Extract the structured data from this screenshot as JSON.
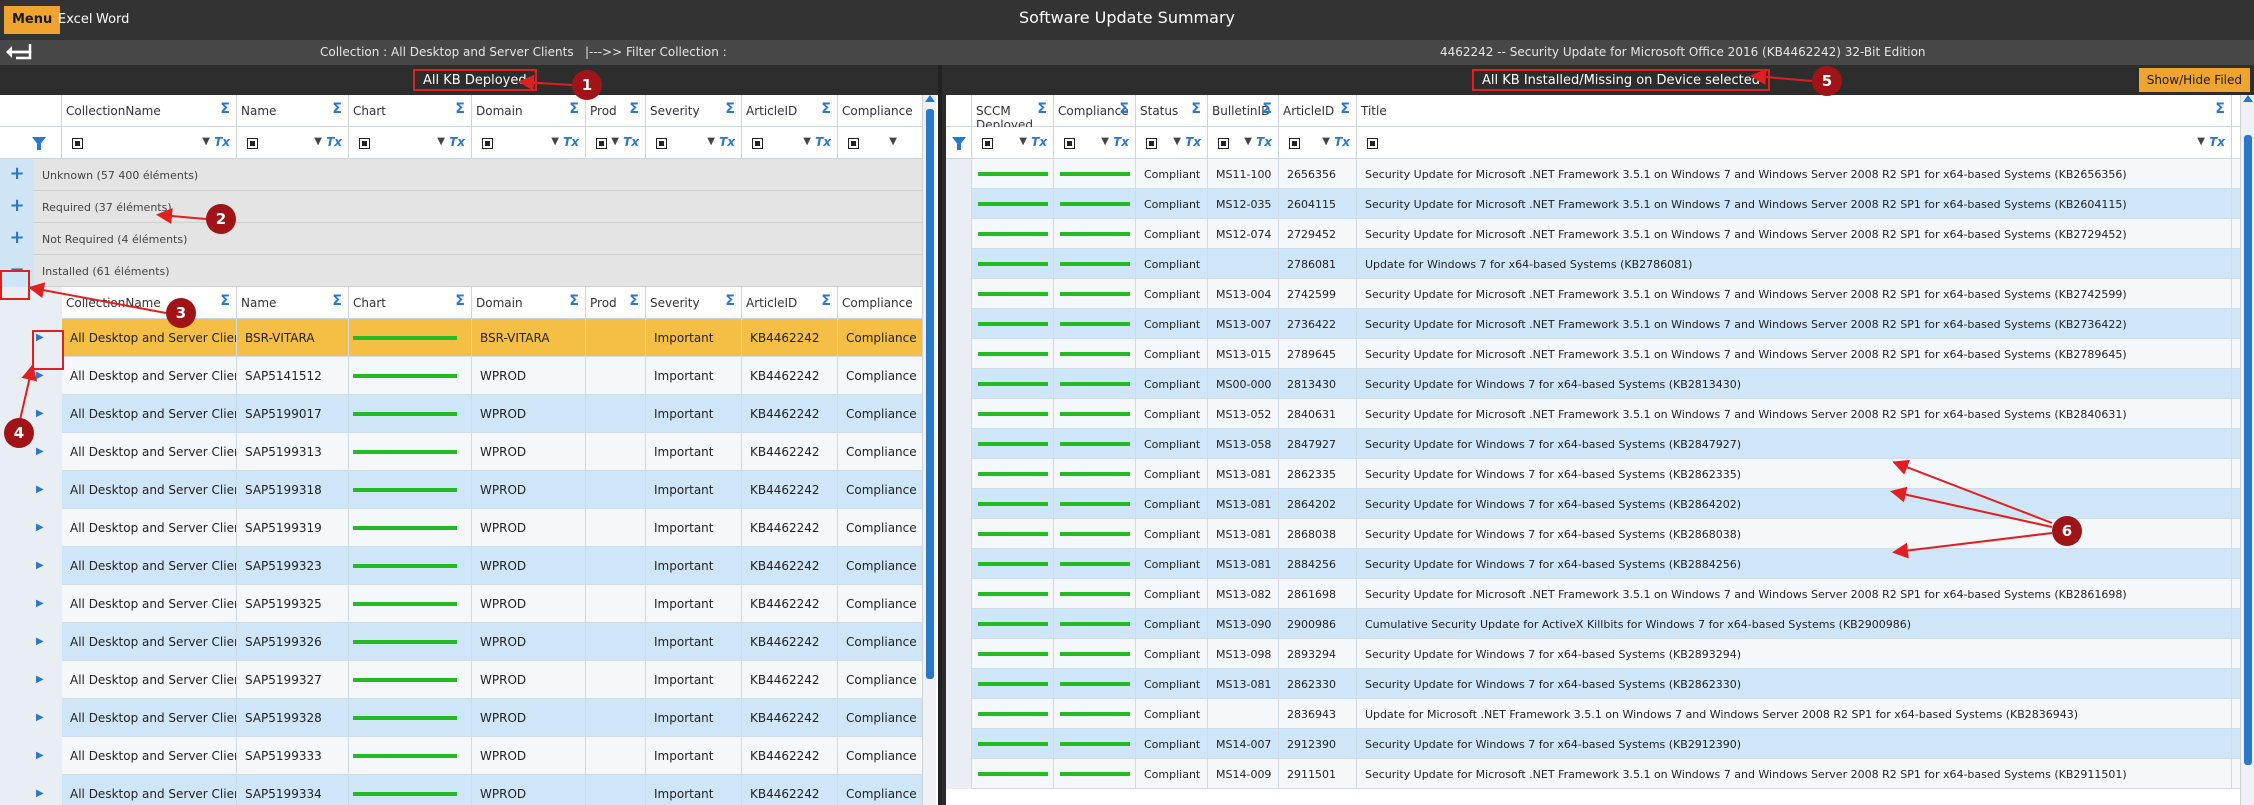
{
  "menu": {
    "menu_label": "Menu",
    "excel_label": "Excel",
    "word_label": "Word"
  },
  "app_title": "Software Update Summary",
  "subbar": {
    "collection_text": "Collection : All Desktop and Server Clients   |--->> Filter Collection :",
    "update_title": "4462242 -- Security Update for Microsoft Office 2016 (KB4462242) 32-Bit Edition"
  },
  "left_pane": {
    "header_label": "All KB Deployed",
    "columns": [
      "CollectionName",
      "Name",
      "Chart",
      "Domain",
      "Prod",
      "Severity",
      "ArticleID",
      "Compliance"
    ],
    "groups": [
      {
        "label": "Unknown (57 400 éléments)",
        "toggle": "+"
      },
      {
        "label": "Required (37 éléments)",
        "toggle": "+"
      },
      {
        "label": "Not Required (4 éléments)",
        "toggle": "+"
      },
      {
        "label": "Installed (61 éléments)",
        "toggle": "−"
      }
    ],
    "rows": [
      {
        "collection": "All Desktop and Server Clients",
        "name": "BSR-VITARA",
        "domain": "BSR-VITARA",
        "prod": "",
        "severity": "Important",
        "article": "KB4462242",
        "compliance": "Compliance"
      },
      {
        "collection": "All Desktop and Server Clients",
        "name": "SAP5141512",
        "domain": "WPROD",
        "prod": "",
        "severity": "Important",
        "article": "KB4462242",
        "compliance": "Compliance"
      },
      {
        "collection": "All Desktop and Server Clients",
        "name": "SAP5199017",
        "domain": "WPROD",
        "prod": "",
        "severity": "Important",
        "article": "KB4462242",
        "compliance": "Compliance"
      },
      {
        "collection": "All Desktop and Server Clients",
        "name": "SAP5199313",
        "domain": "WPROD",
        "prod": "",
        "severity": "Important",
        "article": "KB4462242",
        "compliance": "Compliance"
      },
      {
        "collection": "All Desktop and Server Clients",
        "name": "SAP5199318",
        "domain": "WPROD",
        "prod": "",
        "severity": "Important",
        "article": "KB4462242",
        "compliance": "Compliance"
      },
      {
        "collection": "All Desktop and Server Clients",
        "name": "SAP5199319",
        "domain": "WPROD",
        "prod": "",
        "severity": "Important",
        "article": "KB4462242",
        "compliance": "Compliance"
      },
      {
        "collection": "All Desktop and Server Clients",
        "name": "SAP5199323",
        "domain": "WPROD",
        "prod": "",
        "severity": "Important",
        "article": "KB4462242",
        "compliance": "Compliance"
      },
      {
        "collection": "All Desktop and Server Clients",
        "name": "SAP5199325",
        "domain": "WPROD",
        "prod": "",
        "severity": "Important",
        "article": "KB4462242",
        "compliance": "Compliance"
      },
      {
        "collection": "All Desktop and Server Clients",
        "name": "SAP5199326",
        "domain": "WPROD",
        "prod": "",
        "severity": "Important",
        "article": "KB4462242",
        "compliance": "Compliance"
      },
      {
        "collection": "All Desktop and Server Clients",
        "name": "SAP5199327",
        "domain": "WPROD",
        "prod": "",
        "severity": "Important",
        "article": "KB4462242",
        "compliance": "Compliance"
      },
      {
        "collection": "All Desktop and Server Clients",
        "name": "SAP5199328",
        "domain": "WPROD",
        "prod": "",
        "severity": "Important",
        "article": "KB4462242",
        "compliance": "Compliance"
      },
      {
        "collection": "All Desktop and Server Clients",
        "name": "SAP5199333",
        "domain": "WPROD",
        "prod": "",
        "severity": "Important",
        "article": "KB4462242",
        "compliance": "Compliance"
      },
      {
        "collection": "All Desktop and Server Clients",
        "name": "SAP5199334",
        "domain": "WPROD",
        "prod": "",
        "severity": "Important",
        "article": "KB4462242",
        "compliance": "Compliance"
      }
    ]
  },
  "right_pane": {
    "header_label": "All KB Installed/Missing on Device selected",
    "showhide_label": "Show/Hide Filed",
    "columns": [
      "SCCM Deployed",
      "Compliance",
      "Status",
      "BulletinID",
      "ArticleID",
      "Title"
    ],
    "rows": [
      {
        "status": "Compliant",
        "bulletin": "MS11-100",
        "article": "2656356",
        "title": "Security Update for Microsoft .NET Framework 3.5.1 on Windows 7 and Windows Server 2008 R2 SP1 for x64-based Systems (KB2656356)"
      },
      {
        "status": "Compliant",
        "bulletin": "MS12-035",
        "article": "2604115",
        "title": "Security Update for Microsoft .NET Framework 3.5.1 on Windows 7 and Windows Server 2008 R2 SP1 for x64-based Systems (KB2604115)"
      },
      {
        "status": "Compliant",
        "bulletin": "MS12-074",
        "article": "2729452",
        "title": "Security Update for Microsoft .NET Framework 3.5.1 on Windows 7 and Windows Server 2008 R2 SP1 for x64-based Systems (KB2729452)"
      },
      {
        "status": "Compliant",
        "bulletin": "",
        "article": "2786081",
        "title": "Update for Windows 7 for x64-based Systems (KB2786081)"
      },
      {
        "status": "Compliant",
        "bulletin": "MS13-004",
        "article": "2742599",
        "title": "Security Update for Microsoft .NET Framework 3.5.1 on Windows 7 and Windows Server 2008 R2 SP1 for x64-based Systems (KB2742599)"
      },
      {
        "status": "Compliant",
        "bulletin": "MS13-007",
        "article": "2736422",
        "title": "Security Update for Microsoft .NET Framework 3.5.1 on Windows 7 and Windows Server 2008 R2 SP1 for x64-based Systems (KB2736422)"
      },
      {
        "status": "Compliant",
        "bulletin": "MS13-015",
        "article": "2789645",
        "title": "Security Update for Microsoft .NET Framework 3.5.1 on Windows 7 and Windows Server 2008 R2 SP1 for x64-based Systems (KB2789645)"
      },
      {
        "status": "Compliant",
        "bulletin": "MS00-000",
        "article": "2813430",
        "title": "Security Update for Windows 7 for x64-based Systems (KB2813430)"
      },
      {
        "status": "Compliant",
        "bulletin": "MS13-052",
        "article": "2840631",
        "title": "Security Update for Microsoft .NET Framework 3.5.1 on Windows 7 and Windows Server 2008 R2 SP1 for x64-based Systems (KB2840631)"
      },
      {
        "status": "Compliant",
        "bulletin": "MS13-058",
        "article": "2847927",
        "title": "Security Update for Windows 7 for x64-based Systems (KB2847927)"
      },
      {
        "status": "Compliant",
        "bulletin": "MS13-081",
        "article": "2862335",
        "title": "Security Update for Windows 7 for x64-based Systems (KB2862335)"
      },
      {
        "status": "Compliant",
        "bulletin": "MS13-081",
        "article": "2864202",
        "title": "Security Update for Windows 7 for x64-based Systems (KB2864202)"
      },
      {
        "status": "Compliant",
        "bulletin": "MS13-081",
        "article": "2868038",
        "title": "Security Update for Windows 7 for x64-based Systems (KB2868038)"
      },
      {
        "status": "Compliant",
        "bulletin": "MS13-081",
        "article": "2884256",
        "title": "Security Update for Windows 7 for x64-based Systems (KB2884256)"
      },
      {
        "status": "Compliant",
        "bulletin": "MS13-082",
        "article": "2861698",
        "title": "Security Update for Microsoft .NET Framework 3.5.1 on Windows 7 and Windows Server 2008 R2 SP1 for x64-based Systems (KB2861698)"
      },
      {
        "status": "Compliant",
        "bulletin": "MS13-090",
        "article": "2900986",
        "title": "Cumulative Security Update for ActiveX Killbits for Windows 7 for x64-based Systems (KB2900986)"
      },
      {
        "status": "Compliant",
        "bulletin": "MS13-098",
        "article": "2893294",
        "title": "Security Update for Windows 7 for x64-based Systems (KB2893294)"
      },
      {
        "status": "Compliant",
        "bulletin": "MS13-081",
        "article": "2862330",
        "title": "Security Update for Windows 7 for x64-based Systems (KB2862330)"
      },
      {
        "status": "Compliant",
        "bulletin": "",
        "article": "2836943",
        "title": "Update for Microsoft .NET Framework 3.5.1 on Windows 7 and Windows Server 2008 R2 SP1 for x64-based Systems (KB2836943)"
      },
      {
        "status": "Compliant",
        "bulletin": "MS14-007",
        "article": "2912390",
        "title": "Security Update for Windows 7 for x64-based Systems (KB2912390)"
      },
      {
        "status": "Compliant",
        "bulletin": "MS14-009",
        "article": "2911501",
        "title": "Security Update for Microsoft .NET Framework 3.5.1 on Windows 7 and Windows Server 2008 R2 SP1 for x64-based Systems (KB2911501)"
      }
    ]
  },
  "callouts": [
    "1",
    "2",
    "3",
    "4",
    "5",
    "6"
  ],
  "colors": {
    "accent": "#f0a430",
    "annotation": "#e02020",
    "callout": "#a01418",
    "bar": "#22bb22",
    "row_alt": "#cfe6f8",
    "row_selected": "#f5bf45"
  },
  "icons": [
    "back-arrow-icon",
    "filter-funnel-icon",
    "sigma-icon",
    "clear-filter-icon",
    "dropdown-icon",
    "expand-plus-icon",
    "collapse-minus-icon",
    "row-expand-icon"
  ]
}
